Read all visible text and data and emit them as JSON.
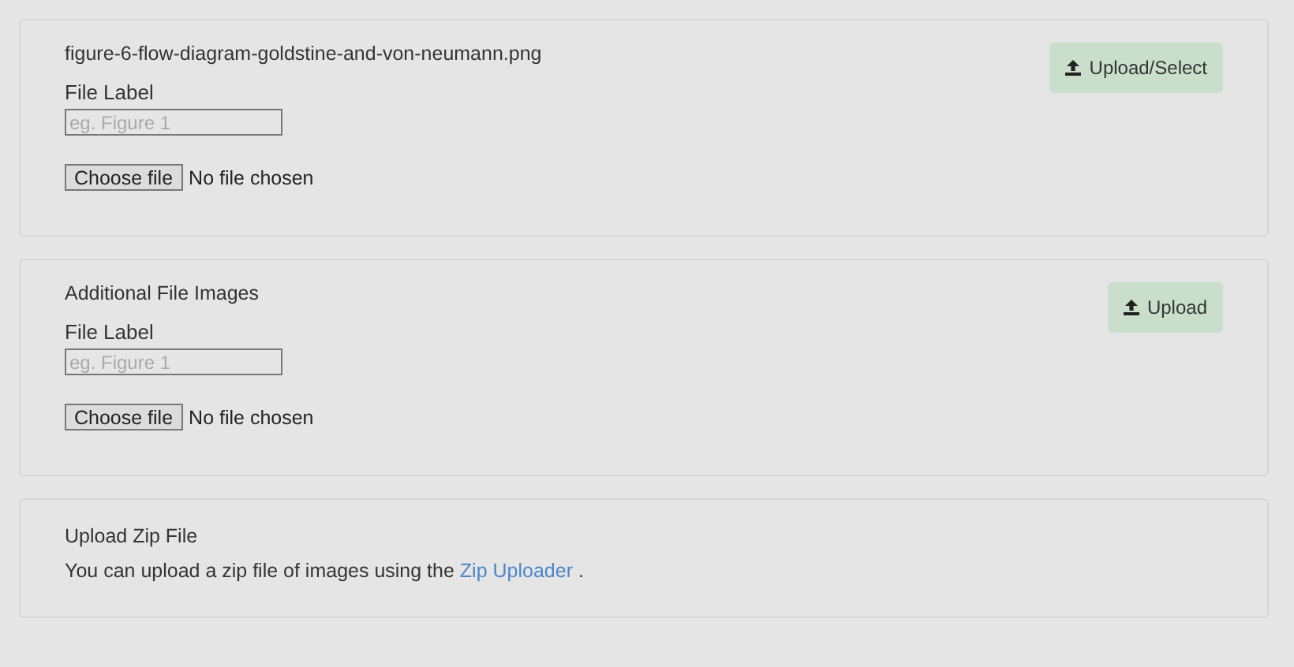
{
  "panels": [
    {
      "title": "figure-6-flow-diagram-goldstine-and-von-neumann.png",
      "field_label": "File Label",
      "placeholder": "eg. Figure 1",
      "choose_button": "Choose file",
      "file_status": "No file chosen",
      "action_button": "Upload/Select"
    },
    {
      "title": "Additional File Images",
      "field_label": "File Label",
      "placeholder": "eg. Figure 1",
      "choose_button": "Choose file",
      "file_status": "No file chosen",
      "action_button": "Upload"
    }
  ],
  "zip": {
    "title": "Upload Zip File",
    "text_before": "You can upload a zip file of images using the",
    "link": "Zip Uploader",
    "text_after": "."
  }
}
